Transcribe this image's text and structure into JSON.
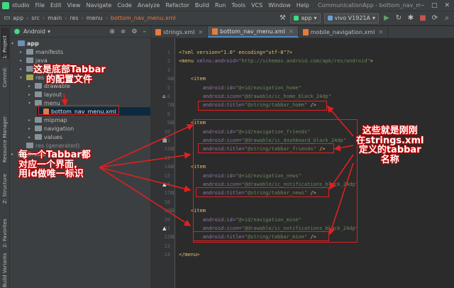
{
  "menubar": {
    "app_label": "studio",
    "items": [
      "File",
      "Edit",
      "View",
      "Navigate",
      "Code",
      "Analyze",
      "Refactor",
      "Build",
      "Run",
      "Tools",
      "VCS",
      "Window",
      "Help"
    ],
    "window_title": "CommunicationApp - bottom_nav_menu.xml [CommunicationApp.app]"
  },
  "navbar": {
    "crumbs": [
      "app",
      "src",
      "main",
      "res",
      "menu"
    ],
    "file": "bottom_nav_menu.xml",
    "config": "app",
    "device": "vivo V1921A"
  },
  "toolstrip": {
    "project": "1: Project",
    "commit": "Commit",
    "resource_manager": "Resource Manager",
    "structure": "Z: Structure",
    "favorites": "2: Favorites",
    "build_variants": "Build Variants"
  },
  "project_panel": {
    "view": "Android",
    "tree": [
      {
        "label": "app",
        "level": 0,
        "kind": "folder-blue",
        "arrow": "▾"
      },
      {
        "label": "manifests",
        "level": 1,
        "kind": "folder",
        "arrow": "▸"
      },
      {
        "label": "java",
        "level": 1,
        "kind": "folder",
        "arrow": "▸"
      },
      {
        "label": "java",
        "level": 1,
        "kind": "folder",
        "arrow": "▸"
      },
      {
        "label": "res",
        "level": 1,
        "kind": "folder-res",
        "arrow": "▾"
      },
      {
        "label": "drawable",
        "level": 2,
        "kind": "folder",
        "arrow": "▸"
      },
      {
        "label": "layout",
        "level": 2,
        "kind": "folder",
        "arrow": "▸"
      },
      {
        "label": "menu",
        "level": 2,
        "kind": "folder",
        "arrow": "▾"
      },
      {
        "label": "bottom_nav_menu.xml",
        "level": 3,
        "kind": "xml",
        "arrow": ""
      },
      {
        "label": "mipmap",
        "level": 2,
        "kind": "folder",
        "arrow": "▸"
      },
      {
        "label": "navigation",
        "level": 2,
        "kind": "folder",
        "arrow": "▸"
      },
      {
        "label": "values",
        "level": 2,
        "kind": "folder",
        "arrow": "▸"
      },
      {
        "label": "res (generated)",
        "level": 1,
        "kind": "folder",
        "arrow": ""
      },
      {
        "label": "Gradle Scripts",
        "level": 0,
        "kind": "folder",
        "arrow": "▸"
      }
    ]
  },
  "tabs": [
    {
      "label": "strings.xml",
      "active": false
    },
    {
      "label": "bottom_nav_menu.xml",
      "active": true
    },
    {
      "label": "mobile_navigation.xml",
      "active": false
    }
  ],
  "editor": {
    "lines": [
      [
        [
          "c-decl",
          "<?xml version=\"1.0\" encoding=\"utf-8\"?>"
        ]
      ],
      [
        [
          "c-tag",
          "<menu "
        ],
        [
          "c-attr",
          "xmlns:android="
        ],
        [
          "c-val",
          "\"http://schemas.android.com/apk/res/android\""
        ],
        [
          "c-tag",
          ">"
        ]
      ],
      [],
      [
        [
          "c-txt",
          "    "
        ],
        [
          "c-tag",
          "<item"
        ]
      ],
      [
        [
          "c-txt",
          "        "
        ],
        [
          "c-attr",
          "android:id="
        ],
        [
          "c-val",
          "\"@+id/navigation_home\""
        ]
      ],
      [
        [
          "c-txt",
          "        "
        ],
        [
          "c-attr",
          "android:icon="
        ],
        [
          "c-val",
          "\"@drawable/ic_home_black_24dp\""
        ]
      ],
      [
        [
          "c-txt",
          "        "
        ],
        [
          "c-attr",
          "android:title="
        ],
        [
          "c-val",
          "\"@string/tabbar_home\""
        ],
        [
          "c-tag",
          " />"
        ]
      ],
      [],
      [
        [
          "c-txt",
          "    "
        ],
        [
          "c-tag",
          "<item"
        ]
      ],
      [
        [
          "c-txt",
          "        "
        ],
        [
          "c-attr",
          "android:id="
        ],
        [
          "c-val",
          "\"@+id/navigation_friends\""
        ]
      ],
      [
        [
          "c-txt",
          "        "
        ],
        [
          "c-attr",
          "android:icon="
        ],
        [
          "c-val",
          "\"@drawable/ic_dashboard_black_24dp\""
        ]
      ],
      [
        [
          "c-txt",
          "        "
        ],
        [
          "c-attr",
          "android:title="
        ],
        [
          "c-val",
          "\"@string/tabbar_friends\""
        ],
        [
          "c-tag",
          " />"
        ]
      ],
      [],
      [
        [
          "c-txt",
          "    "
        ],
        [
          "c-tag",
          "<item"
        ]
      ],
      [
        [
          "c-txt",
          "        "
        ],
        [
          "c-attr",
          "android:id="
        ],
        [
          "c-val",
          "\"@+id/navigation_news\""
        ]
      ],
      [
        [
          "c-txt",
          "        "
        ],
        [
          "c-attr",
          "android:icon="
        ],
        [
          "c-val",
          "\"@drawable/ic_notifications_black_24dp\""
        ]
      ],
      [
        [
          "c-txt",
          "        "
        ],
        [
          "c-attr",
          "android:title="
        ],
        [
          "c-val",
          "\"@string/tabbar_news\""
        ],
        [
          "c-tag",
          " />"
        ]
      ],
      [],
      [
        [
          "c-txt",
          "    "
        ],
        [
          "c-tag",
          "<item"
        ]
      ],
      [
        [
          "c-txt",
          "        "
        ],
        [
          "c-attr",
          "android:id="
        ],
        [
          "c-val",
          "\"@+id/navigation_mine\""
        ]
      ],
      [
        [
          "c-txt",
          "        "
        ],
        [
          "c-attr",
          "android:icon="
        ],
        [
          "c-val",
          "\"@drawable/ic_notifications_black_24dp\""
        ]
      ],
      [
        [
          "c-txt",
          "        "
        ],
        [
          "c-attr",
          "android:title="
        ],
        [
          "c-val",
          "\"@string/tabbar_mine\""
        ],
        [
          "c-tag",
          " />"
        ]
      ],
      [],
      [
        [
          "c-tag",
          "</menu>"
        ]
      ]
    ]
  },
  "annotations": {
    "note1_line1": "这是底部Tabbar",
    "note1_line2": "的配置文件",
    "note2_line1": "每一个Tabbar都",
    "note2_line2": "对应一个界面,",
    "note2_line3": "用id做唯一标识",
    "note3_line1": "这些就是刚刚",
    "note3_line2": "在strings.xml",
    "note3_line3": "定义的tabbar",
    "note3_line4": "名称"
  }
}
